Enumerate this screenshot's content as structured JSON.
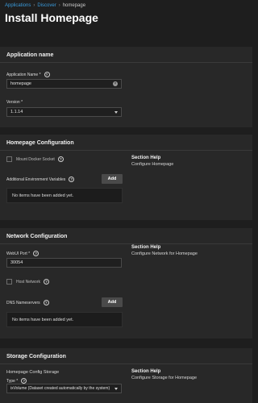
{
  "breadcrumb": {
    "applications": "Applications",
    "discover": "Discover",
    "current": "homepage",
    "separator": "›"
  },
  "page": {
    "title": "Install Homepage"
  },
  "app_name": {
    "section_title": "Application name",
    "name_label": "Application Name *",
    "name_value": "homepage",
    "version_label": "Version *",
    "version_value": "1.1.14"
  },
  "homepage_config": {
    "section_title": "Homepage Configuration",
    "mount_docker_label": "Mount Docker Socket",
    "env_vars_label": "Additional Environment Variables",
    "add_label": "Add",
    "empty_text": "No items have been added yet.",
    "help_title": "Section Help",
    "help_text": "Configure Homepage"
  },
  "network_config": {
    "section_title": "Network Configuration",
    "webui_port_label": "WebUI Port *",
    "webui_port_value": "30054",
    "host_network_label": "Host Network",
    "dns_label": "DNS Nameservers",
    "add_label": "Add",
    "empty_text": "No items have been added yet.",
    "help_title": "Section Help",
    "help_text": "Configure Network for Homepage"
  },
  "storage_config": {
    "section_title": "Storage Configuration",
    "config_storage_label": "Homepage Config Storage",
    "type_label": "Type *",
    "type_value": "ixVolume (Dataset created automatically by the system)",
    "help_title": "Section Help",
    "help_text": "Configure Storage for Homepage"
  },
  "icons": {
    "help": "help-circle-icon",
    "clear": "clear-icon",
    "dropdown": "chevron-down-icon"
  }
}
